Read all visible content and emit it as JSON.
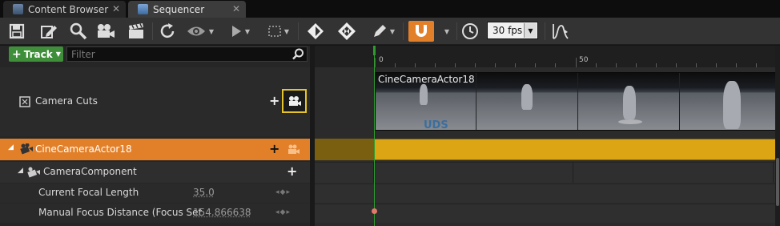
{
  "tabs": [
    {
      "label": "Content Browser",
      "active": false
    },
    {
      "label": "Sequencer",
      "active": true
    }
  ],
  "toolbar": {
    "fps": "30 fps",
    "snap_color": "#e2802a",
    "icons": [
      "save-icon",
      "edit-icon",
      "search-icon",
      "camera-icon",
      "clapper-icon",
      "refresh-icon",
      "eye-icon",
      "play-icon",
      "selection-icon",
      "key-icon",
      "key-all-icon",
      "pen-icon",
      "magnet-icon",
      "clock-icon",
      "curve-editor-icon"
    ]
  },
  "track_button": {
    "label": "Track"
  },
  "filter": {
    "placeholder": "Filter"
  },
  "tracks": {
    "camera_cuts": {
      "label": "Camera Cuts"
    },
    "actor": {
      "label": "CineCameraActor18"
    },
    "component": {
      "label": "CameraComponent"
    },
    "focal": {
      "label": "Current Focal Length",
      "value": "35.0"
    },
    "focus": {
      "label": "Manual Focus Distance (Focus Set",
      "value": "154.866638"
    }
  },
  "timeline": {
    "ruler_labels": [
      "0",
      "50"
    ],
    "camera_section_label": "CineCameraActor18",
    "actor_color": "#dca514"
  }
}
